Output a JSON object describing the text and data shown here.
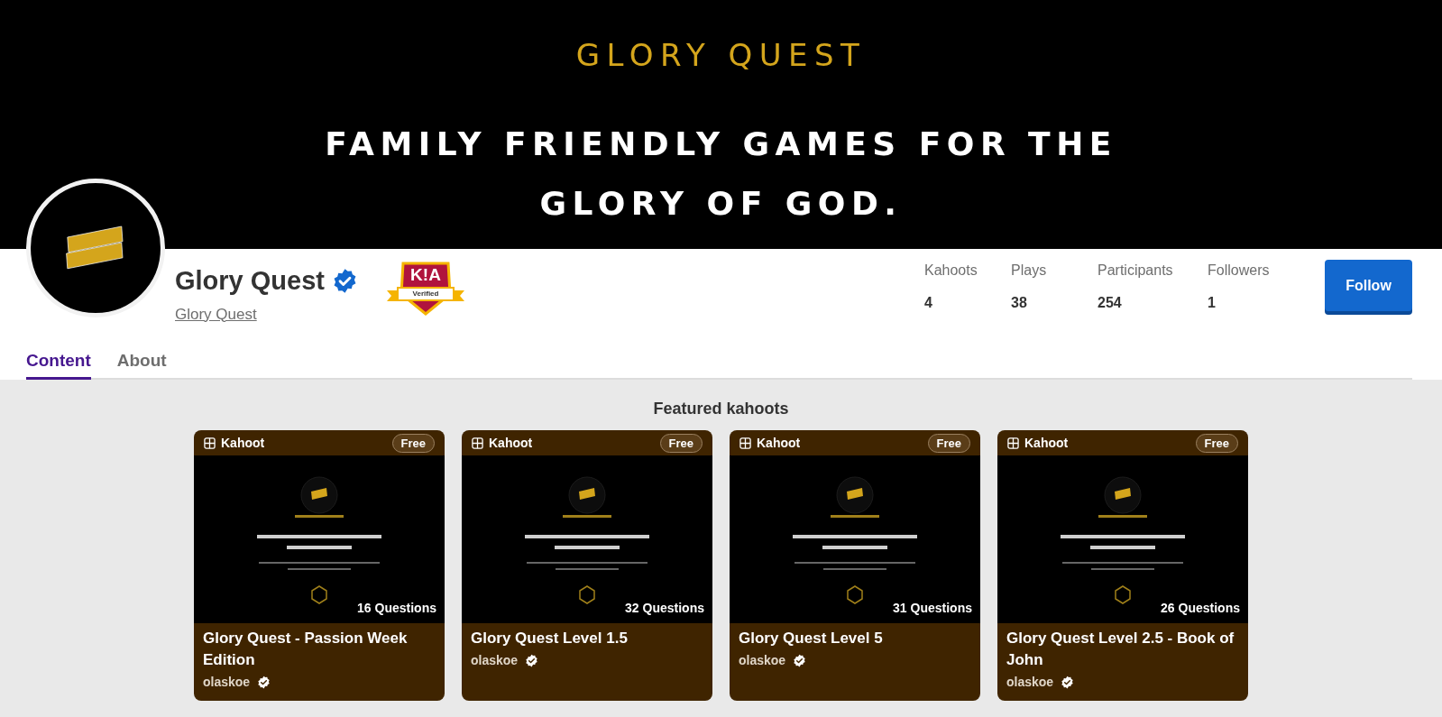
{
  "banner": {
    "title": "GLORY QUEST",
    "tagline_lines": [
      "FAMILY FRIENDLY GAMES FOR THE",
      "GLORY OF GOD."
    ]
  },
  "profile": {
    "name": "Glory Quest",
    "verified": true,
    "handle": "Glory Quest",
    "badge": {
      "logo": "K!A",
      "label": "Verified"
    }
  },
  "stats": [
    {
      "label": "Kahoots",
      "value": "4"
    },
    {
      "label": "Plays",
      "value": "38"
    },
    {
      "label": "Participants",
      "value": "254"
    },
    {
      "label": "Followers",
      "value": "1"
    }
  ],
  "follow_button": "Follow",
  "tabs": [
    {
      "label": "Content",
      "selected": true
    },
    {
      "label": "About",
      "selected": false
    }
  ],
  "featured": {
    "title": "Featured kahoots",
    "cards": [
      {
        "type": "Kahoot",
        "price": "Free",
        "questions": "16 Questions",
        "title": "Glory Quest - Passion Week Edition",
        "author": "olaskoe",
        "author_verified": true
      },
      {
        "type": "Kahoot",
        "price": "Free",
        "questions": "32 Questions",
        "title": "Glory Quest Level 1.5",
        "author": "olaskoe",
        "author_verified": true
      },
      {
        "type": "Kahoot",
        "price": "Free",
        "questions": "31 Questions",
        "title": "Glory Quest Level 5",
        "author": "olaskoe",
        "author_verified": true
      },
      {
        "type": "Kahoot",
        "price": "Free",
        "questions": "26 Questions",
        "title": "Glory Quest Level 2.5 - Book of John",
        "author": "olaskoe",
        "author_verified": true
      }
    ]
  }
}
